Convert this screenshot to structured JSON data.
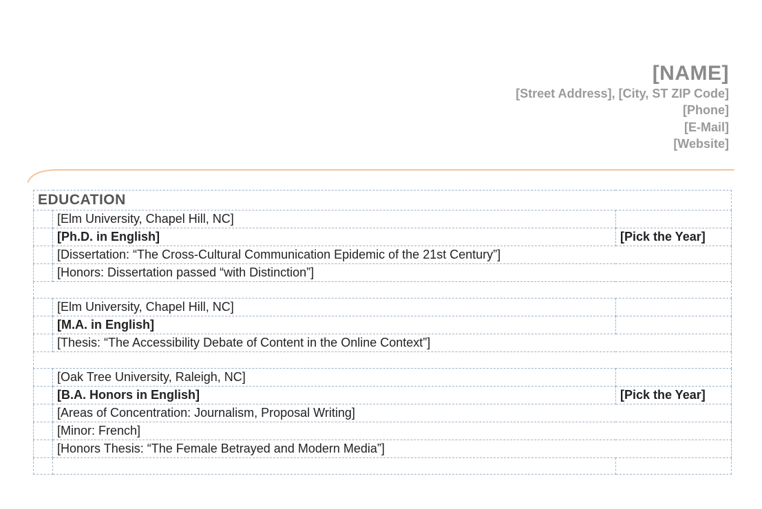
{
  "header": {
    "name_placeholder": "[NAME]",
    "address_line": "[Street Address], [City, ST  ZIP Code]",
    "phone": "[Phone]",
    "email": "[E-Mail]",
    "website": "[Website]"
  },
  "education": {
    "section_title": "EDUCATION",
    "entries": [
      {
        "school": "[Elm University, Chapel Hill, NC]",
        "degree": "[Ph.D. in English]",
        "year": "[Pick the Year]",
        "lines": [
          "[Dissertation: “The Cross-Cultural Communication Epidemic of the 21st Century”]",
          "[Honors: Dissertation passed “with Distinction”]"
        ]
      },
      {
        "school": "[Elm University, Chapel Hill, NC]",
        "degree": "[M.A. in English]",
        "year": "",
        "lines": [
          "[Thesis: “The Accessibility Debate of Content in the Online Context”]"
        ]
      },
      {
        "school": "[Oak Tree University, Raleigh, NC]",
        "degree": "[B.A. Honors in English]",
        "year": "[Pick the Year]",
        "lines": [
          "[Areas of Concentration: Journalism, Proposal Writing]",
          "[Minor: French]",
          "[Honors Thesis: “The Female Betrayed and Modern Media”]"
        ]
      }
    ]
  }
}
